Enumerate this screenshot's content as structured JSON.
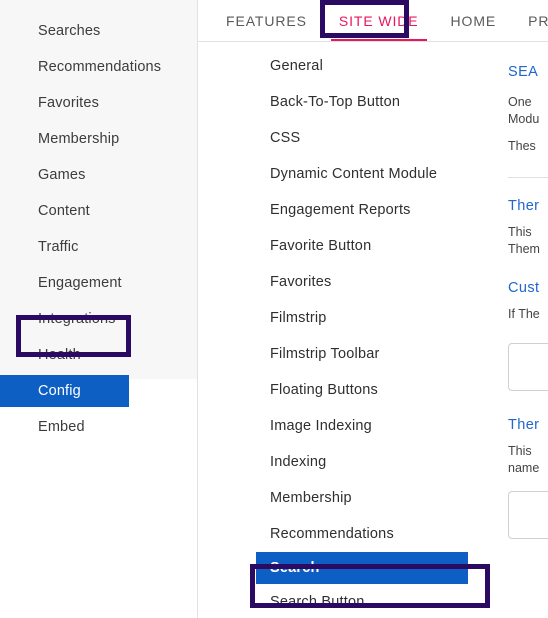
{
  "sidebar": {
    "items": [
      {
        "label": "Searches",
        "active": false
      },
      {
        "label": "Recommendations",
        "active": false
      },
      {
        "label": "Favorites",
        "active": false
      },
      {
        "label": "Membership",
        "active": false
      },
      {
        "label": "Games",
        "active": false
      },
      {
        "label": "Content",
        "active": false
      },
      {
        "label": "Traffic",
        "active": false
      },
      {
        "label": "Engagement",
        "active": false
      },
      {
        "label": "Integrations",
        "active": false
      },
      {
        "label": "Health",
        "active": false
      },
      {
        "label": "Config",
        "active": true
      },
      {
        "label": "Embed",
        "active": false
      }
    ]
  },
  "tabs": {
    "items": [
      {
        "label": "FEATURES",
        "active": false
      },
      {
        "label": "SITE WIDE",
        "active": true
      },
      {
        "label": "HOME",
        "active": false
      },
      {
        "label": "PR",
        "active": false
      }
    ]
  },
  "menu": {
    "items": [
      {
        "label": "General",
        "active": false
      },
      {
        "label": "Back-To-Top Button",
        "active": false
      },
      {
        "label": "CSS",
        "active": false
      },
      {
        "label": "Dynamic Content Module",
        "active": false
      },
      {
        "label": "Engagement Reports",
        "active": false
      },
      {
        "label": "Favorite Button",
        "active": false
      },
      {
        "label": "Favorites",
        "active": false
      },
      {
        "label": "Filmstrip",
        "active": false
      },
      {
        "label": "Filmstrip Toolbar",
        "active": false
      },
      {
        "label": "Floating Buttons",
        "active": false
      },
      {
        "label": "Image Indexing",
        "active": false
      },
      {
        "label": "Indexing",
        "active": false
      },
      {
        "label": "Membership",
        "active": false
      },
      {
        "label": "Recommendations",
        "active": false
      },
      {
        "label": "Search",
        "active": true
      },
      {
        "label": "Search Button",
        "active": false
      }
    ]
  },
  "content": {
    "section_title": "SEA",
    "intro_line_1": "One",
    "intro_line_2": "Modu",
    "intro_line_3": "Thes",
    "heading_theme": "Ther",
    "theme_line_1": "This",
    "theme_line_2": "Them",
    "heading_custom": "Cust",
    "custom_line_1": "If The",
    "heading_theme_2": "Ther",
    "theme2_line_1": "This",
    "theme2_line_2": "name"
  },
  "colors": {
    "accent_blue": "#0d5fc4",
    "tab_active": "#e8175d",
    "annotation": "#2b0a61",
    "heading_blue": "#2266cc",
    "sidebar_bg": "#f7f7f7"
  }
}
